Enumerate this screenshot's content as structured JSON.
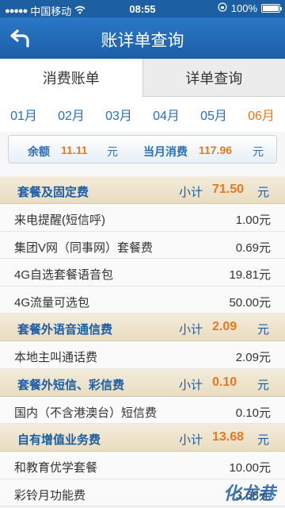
{
  "status": {
    "carrier": "中国移动",
    "time": "08:55",
    "battery": "100%"
  },
  "nav": {
    "title": "账详单查询"
  },
  "tabs": [
    {
      "label": "消费账单"
    },
    {
      "label": "详单查询"
    }
  ],
  "months": [
    "01月",
    "02月",
    "03月",
    "04月",
    "05月",
    "06月"
  ],
  "balance": {
    "balance_label": "余额",
    "balance_value": "11.11",
    "unit": "元",
    "month_label": "当月消费",
    "month_value": "117.96"
  },
  "sections": [
    {
      "title": "套餐及固定费",
      "subtotal_label": "小计",
      "subtotal": "71.50",
      "unit": "元",
      "items": [
        {
          "name": "来电提醒(短信呼)",
          "amount": "1.00元"
        },
        {
          "name": "集团V网（同事网）套餐费",
          "amount": "0.69元"
        },
        {
          "name": "4G自选套餐语音包",
          "amount": "19.81元"
        },
        {
          "name": "4G流量可选包",
          "amount": "50.00元"
        }
      ]
    },
    {
      "title": "套餐外语音通信费",
      "subtotal_label": "小计",
      "subtotal": "2.09",
      "unit": "元",
      "items": [
        {
          "name": "本地主叫通话费",
          "amount": "2.09元"
        }
      ]
    },
    {
      "title": "套餐外短信、彩信费",
      "subtotal_label": "小计",
      "subtotal": "0.10",
      "unit": "元",
      "items": [
        {
          "name": "国内（不含港澳台）短信费",
          "amount": "0.10元"
        }
      ]
    },
    {
      "title": "自有增值业务费",
      "subtotal_label": "小计",
      "subtotal": "13.68",
      "unit": "元",
      "items": [
        {
          "name": "和教育优学套餐",
          "amount": "10.00元"
        },
        {
          "name": "彩铃月功能费",
          "amount": "3.68元"
        }
      ]
    }
  ],
  "watermark": "化龙巷",
  "colors": {
    "header": "#1c5ea6",
    "accent": "#e8781f",
    "section_bg": "#ede2c9"
  }
}
